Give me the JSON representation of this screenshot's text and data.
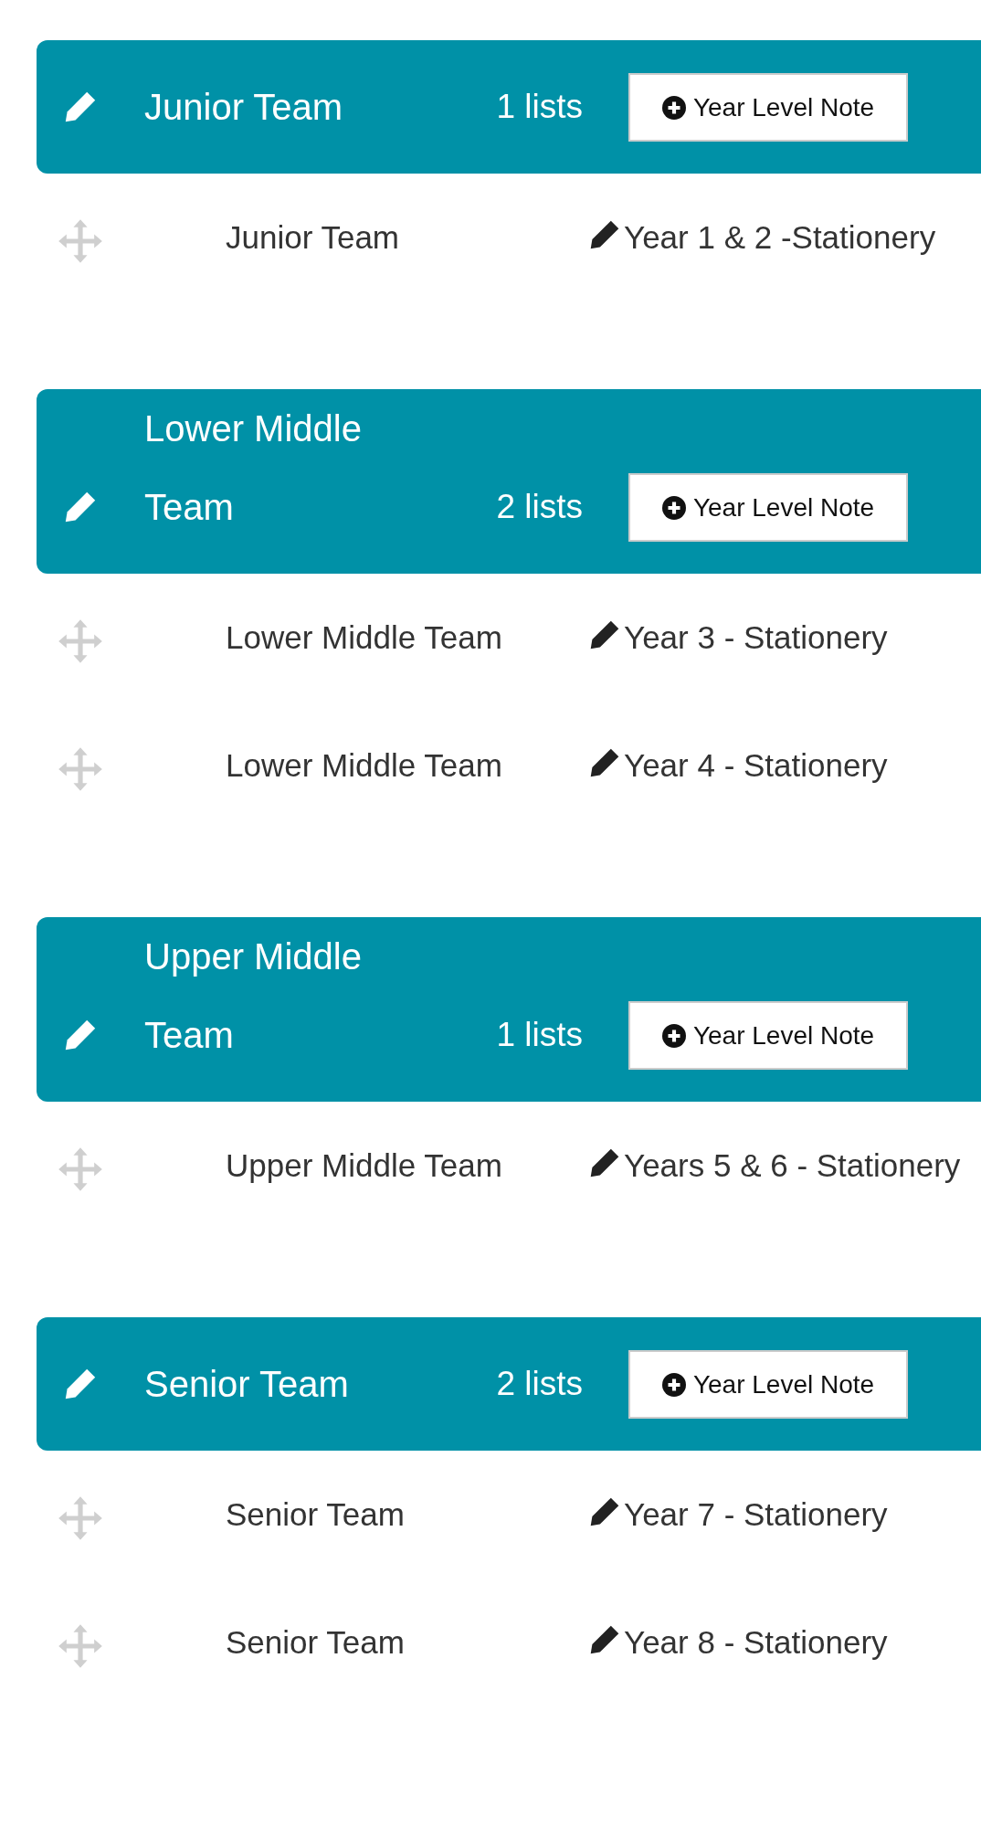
{
  "groups": [
    {
      "title": "Junior Team",
      "count": "1 lists",
      "button": "Year Level Note",
      "lists": [
        {
          "team": "Junior Team",
          "name": "Year 1 & 2 -Stationery"
        }
      ]
    },
    {
      "title": "Lower Middle Team",
      "count": "2 lists",
      "button": "Year Level Note",
      "lists": [
        {
          "team": "Lower Middle Team",
          "name": "Year 3 - Stationery"
        },
        {
          "team": "Lower Middle Team",
          "name": "Year 4 - Stationery"
        }
      ]
    },
    {
      "title": "Upper Middle Team",
      "count": "1 lists",
      "button": "Year Level Note",
      "lists": [
        {
          "team": "Upper Middle Team",
          "name": "Years 5 & 6 - Stationery"
        }
      ]
    },
    {
      "title": "Senior Team",
      "count": "2 lists",
      "button": "Year Level Note",
      "lists": [
        {
          "team": "Senior Team",
          "name": "Year 7 - Stationery"
        },
        {
          "team": "Senior Team",
          "name": "Year 8 - Stationery"
        }
      ]
    }
  ]
}
